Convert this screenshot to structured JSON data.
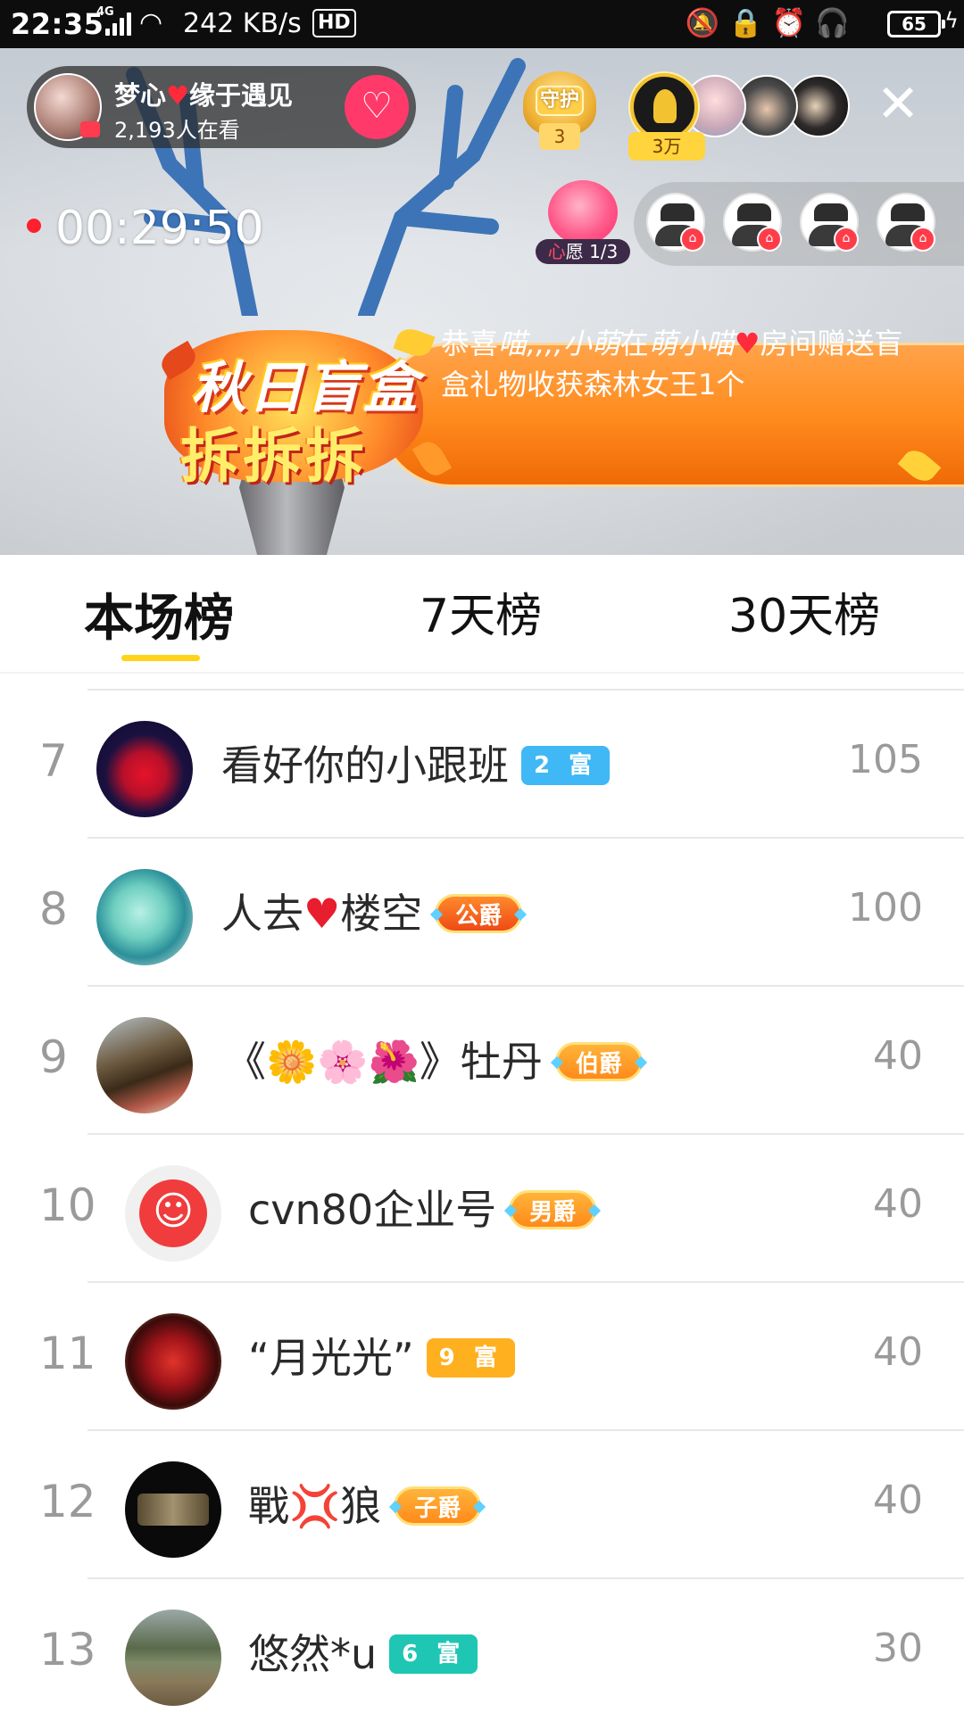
{
  "status_bar": {
    "time": "22:35",
    "network": "4G",
    "speed": "242 KB/s",
    "hd": "HD",
    "battery": "65"
  },
  "live": {
    "anchor": {
      "name_part1": "梦心",
      "name_heart": "♥",
      "name_part2": "缘于遇见",
      "viewers": "2,193人在看",
      "follow_icon": "heart-plus-icon"
    },
    "guard": {
      "label": "守护",
      "count": "3"
    },
    "top_contributor_value": "3万",
    "elapsed": "00:29:50",
    "wish": {
      "prefix": "心",
      "text": "愿 1/3"
    },
    "banner": {
      "logo_line1": "秋日盲盒",
      "logo_line2": "拆拆拆",
      "msg_a": "恭喜",
      "msg_user": "喵,,,,小萌",
      "msg_b": "在",
      "msg_room": "萌小喵",
      "msg_heart": "♥",
      "msg_c": "房间赠送盲盒礼物收获森林女王1个"
    }
  },
  "tabs": [
    {
      "label": "本场榜",
      "active": true
    },
    {
      "label": "7天榜",
      "active": false
    },
    {
      "label": "30天榜",
      "active": false
    }
  ],
  "ranking": [
    {
      "rank": "7",
      "name": "看好你的小跟班",
      "badge": "2 富",
      "badge_type": "rich",
      "badge_color": "#3fb8f5",
      "score": "105"
    },
    {
      "rank": "8",
      "name_a": "人去",
      "name_heart": "♥",
      "name_b": "楼空",
      "badge": "公爵",
      "badge_type": "duke",
      "score": "100"
    },
    {
      "rank": "9",
      "name": "《🌼🌸🌺》牡丹",
      "badge": "伯爵",
      "badge_type": "noble",
      "score": "40"
    },
    {
      "rank": "10",
      "name": "cvn80企业号",
      "badge": "男爵",
      "badge_type": "noble",
      "score": "40"
    },
    {
      "rank": "11",
      "name": "“月光光”",
      "badge": "9 富",
      "badge_type": "rich",
      "badge_color": "#ffb01f",
      "score": "40"
    },
    {
      "rank": "12",
      "name": "戰💢狼",
      "badge": "子爵",
      "badge_type": "noble",
      "score": "40"
    },
    {
      "rank": "13",
      "name": "悠然*u",
      "badge": "6 富",
      "badge_type": "rich",
      "badge_color": "#1fc6b4",
      "score": "30"
    }
  ],
  "colors": {
    "accent_yellow": "#ffd31a",
    "banner_orange": "#ff8c1e",
    "follow_pink": "#ff3a6a",
    "rank_gray": "#9a9a9a"
  }
}
